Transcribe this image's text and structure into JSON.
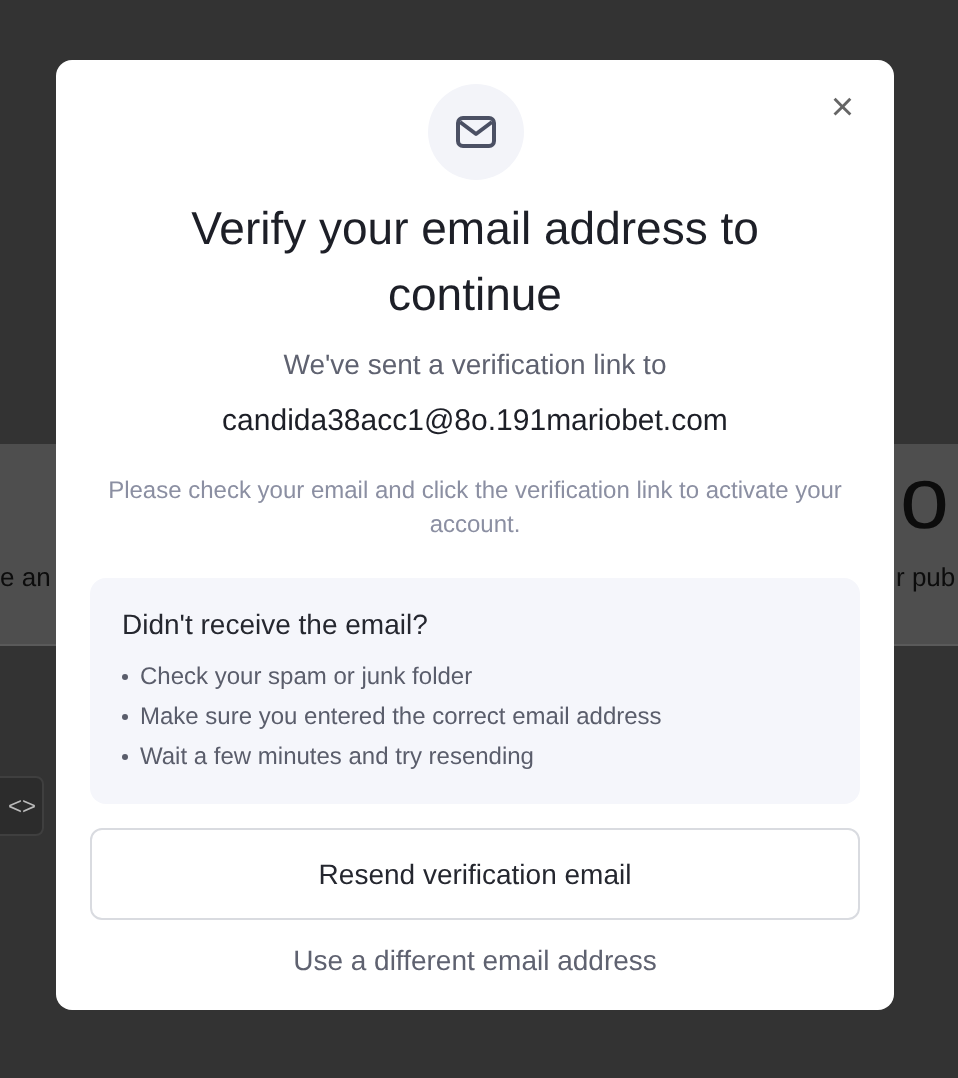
{
  "background": {
    "heading_fragment": "o",
    "left_fragment": "e an",
    "right_fragment": "r pub",
    "code_button": "<>"
  },
  "dialog": {
    "close": "×",
    "title": "Verify your email address to continue",
    "sent_text": "We've sent a verification link to",
    "email": "candida38acc1@8o.191mariobet.com",
    "instructions": "Please check your email and click the verification link to activate your account.",
    "help": {
      "title": "Didn't receive the email?",
      "tips": [
        "Check your spam or junk folder",
        "Make sure you entered the correct email address",
        "Wait a few minutes and try resending"
      ]
    },
    "resend_button": "Resend verification email",
    "change_link": "Use a different email address"
  }
}
